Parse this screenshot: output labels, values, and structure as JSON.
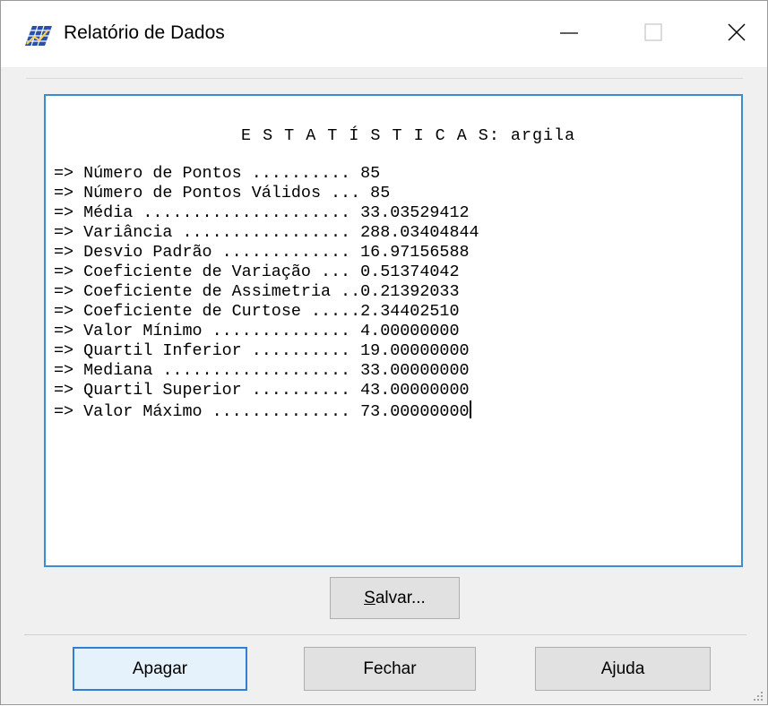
{
  "window": {
    "title": "Relatório de Dados",
    "app_icon": "grid-chart-icon",
    "controls": [
      "minimize-icon",
      "maximize-icon",
      "close-icon"
    ]
  },
  "report": {
    "heading": "E S T A T Í S T I C A S: argila",
    "lines": [
      "=> Número de Pontos .......... 85",
      "=> Número de Pontos Válidos ... 85",
      "=> Média ..................... 33.03529412",
      "=> Variância ................. 288.03404844",
      "=> Desvio Padrão ............. 16.97156588",
      "=> Coeficiente de Variação ... 0.51374042",
      "=> Coeficiente de Assimetria ..0.21392033",
      "=> Coeficiente de Curtose .....2.34402510",
      "=> Valor Mínimo .............. 4.00000000",
      "=> Quartil Inferior .......... 19.00000000",
      "=> Mediana ................... 33.00000000",
      "=> Quartil Superior .......... 43.00000000",
      "=> Valor Máximo .............. 73.00000000"
    ]
  },
  "buttons": {
    "save_mnemonic": "S",
    "save_rest": "alvar...",
    "apagar": "Apagar",
    "fechar": "Fechar",
    "ajuda": "Ajuda"
  },
  "colors": {
    "focus_border": "#3c8cd0",
    "window_bg": "#f0f0f0"
  }
}
